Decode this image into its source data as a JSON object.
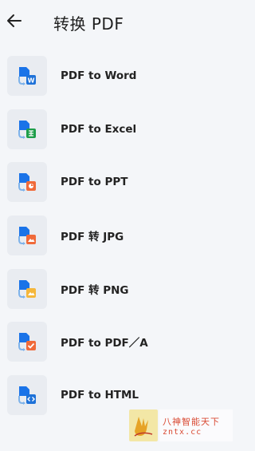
{
  "header": {
    "title": "转换 PDF",
    "back_icon": "arrow-left-icon"
  },
  "items": [
    {
      "label": "PDF to Word",
      "icon": "pdf-to-word-icon",
      "accent": "#1f72d8",
      "badge": "W"
    },
    {
      "label": "PDF to Excel",
      "icon": "pdf-to-excel-icon",
      "accent": "#1e9e4a",
      "badge": ""
    },
    {
      "label": "PDF to PPT",
      "icon": "pdf-to-ppt-icon",
      "accent": "#f06a3a",
      "badge": ""
    },
    {
      "label": "PDF 转 JPG",
      "icon": "pdf-to-jpg-icon",
      "accent": "#f06a3a",
      "badge": ""
    },
    {
      "label": "PDF 转 PNG",
      "icon": "pdf-to-png-icon",
      "accent": "#f5b73b",
      "badge": ""
    },
    {
      "label": "PDF to PDF／A",
      "icon": "pdf-to-pdfa-icon",
      "accent": "#f06a3a",
      "badge": ""
    },
    {
      "label": "PDF to HTML",
      "icon": "pdf-to-html-icon",
      "accent": "#1f72d8",
      "badge": ""
    }
  ],
  "colors": {
    "primary_blue": "#1a73e8",
    "tile_bg": "#e9ecf1"
  },
  "watermark": {
    "line1": "八神智能天下",
    "line2": "zntx.cc"
  }
}
